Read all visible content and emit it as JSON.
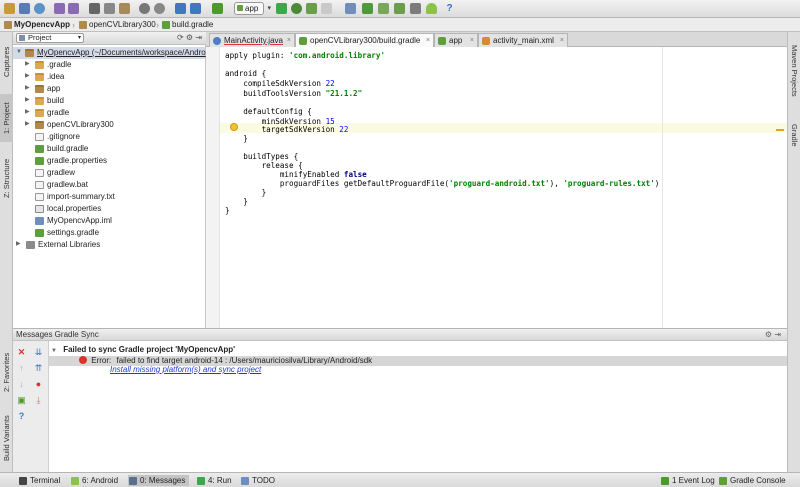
{
  "toolbar": {
    "run_config": "app",
    "icons": [
      "open-icon",
      "save-icon",
      "sync-icon",
      "undo-icon",
      "redo-icon",
      "cut-icon",
      "copy-icon",
      "paste-icon",
      "find-icon",
      "replace-icon",
      "back-icon",
      "forward-icon",
      "build-icon",
      "run-icon",
      "debug-icon",
      "attach-icon",
      "stop-icon",
      "avd-icon",
      "sdk-icon",
      "project-structure-icon",
      "gradle-sync-icon",
      "monitor-icon",
      "android-icon",
      "help-icon"
    ]
  },
  "breadcrumb": [
    "MyOpencvApp",
    "openCVLibrary300",
    "build.gradle"
  ],
  "left_tabs": [
    "Captures",
    "1: Project",
    "Z: Structure",
    "2: Favorites",
    "Build Variants"
  ],
  "right_tabs": [
    "Maven Projects",
    "Gradle"
  ],
  "project_panel": {
    "view_mode": "Project",
    "tree": [
      {
        "label": "MyOpencvApp (~/Documents/workspace/Andro",
        "icon": "module-folder",
        "expanded": true,
        "level": 0
      },
      {
        "label": ".gradle",
        "icon": "folder",
        "expanded": false,
        "level": 1
      },
      {
        "label": ".idea",
        "icon": "folder",
        "expanded": false,
        "level": 1
      },
      {
        "label": "app",
        "icon": "module-folder",
        "expanded": false,
        "level": 1
      },
      {
        "label": "build",
        "icon": "folder",
        "expanded": false,
        "level": 1
      },
      {
        "label": "gradle",
        "icon": "folder",
        "expanded": false,
        "level": 1
      },
      {
        "label": "openCVLibrary300",
        "icon": "module-folder",
        "expanded": false,
        "level": 1
      },
      {
        "label": ".gitignore",
        "icon": "file",
        "level": 1
      },
      {
        "label": "build.gradle",
        "icon": "gradle",
        "level": 1
      },
      {
        "label": "gradle.properties",
        "icon": "gradle",
        "level": 1
      },
      {
        "label": "gradlew",
        "icon": "file",
        "level": 1
      },
      {
        "label": "gradlew.bat",
        "icon": "file",
        "level": 1
      },
      {
        "label": "import-summary.txt",
        "icon": "file",
        "level": 1
      },
      {
        "label": "local.properties",
        "icon": "props",
        "level": 1
      },
      {
        "label": "MyOpencvApp.iml",
        "icon": "iml",
        "level": 1
      },
      {
        "label": "settings.gradle",
        "icon": "gradle",
        "level": 1
      },
      {
        "label": "External Libraries",
        "icon": "library",
        "expanded": false,
        "level": 0
      }
    ]
  },
  "editor_tabs": [
    {
      "label": "MainActivity.java",
      "active": false
    },
    {
      "label": "openCVLibrary300/build.gradle",
      "active": true
    },
    {
      "label": "app",
      "active": false
    },
    {
      "label": "activity_main.xml",
      "active": false
    }
  ],
  "code": {
    "l1a": "apply plugin: ",
    "l1b": "'com.android.library'",
    "l3": "android {",
    "l4a": "    compileSdkVersion ",
    "l4b": "22",
    "l5a": "    buildToolsVersion ",
    "l5b": "\"21.1.2\"",
    "l7": "    defaultConfig {",
    "l8a": "        minSdkVersion ",
    "l8b": "15",
    "l9a": "        targetSdkVersion ",
    "l9b": "22",
    "l10": "    }",
    "l12": "    buildTypes {",
    "l13": "        release {",
    "l14a": "            minifyEnabled ",
    "l14b": "false",
    "l15a": "            proguardFiles getDefaultProguardFile(",
    "l15b": "'proguard-android.txt'",
    "l15c": "), ",
    "l15d": "'proguard-rules.txt'",
    "l16": "        }",
    "l17": "    }",
    "l18": "}"
  },
  "messages": {
    "title": "Messages Gradle Sync",
    "header_line": "Failed to sync Gradle project 'MyOpencvApp'",
    "error_label": "Error:",
    "error_text": "failed to find target android-14 : /Users/mauriciosilva/Library/Android/sdk",
    "fix_link": "Install missing platform(s) and sync project"
  },
  "statusbar": {
    "terminal": "Terminal",
    "android": "6: Android",
    "messages": "0: Messages",
    "run": "4: Run",
    "todo": "TODO",
    "event_log": "1 Event Log",
    "gradle_console": "Gradle Console"
  },
  "colors": {
    "error": "#d9342b",
    "link": "#1b3fd1",
    "string": "#008000",
    "keyword": "#000080",
    "number": "#0000ff"
  }
}
